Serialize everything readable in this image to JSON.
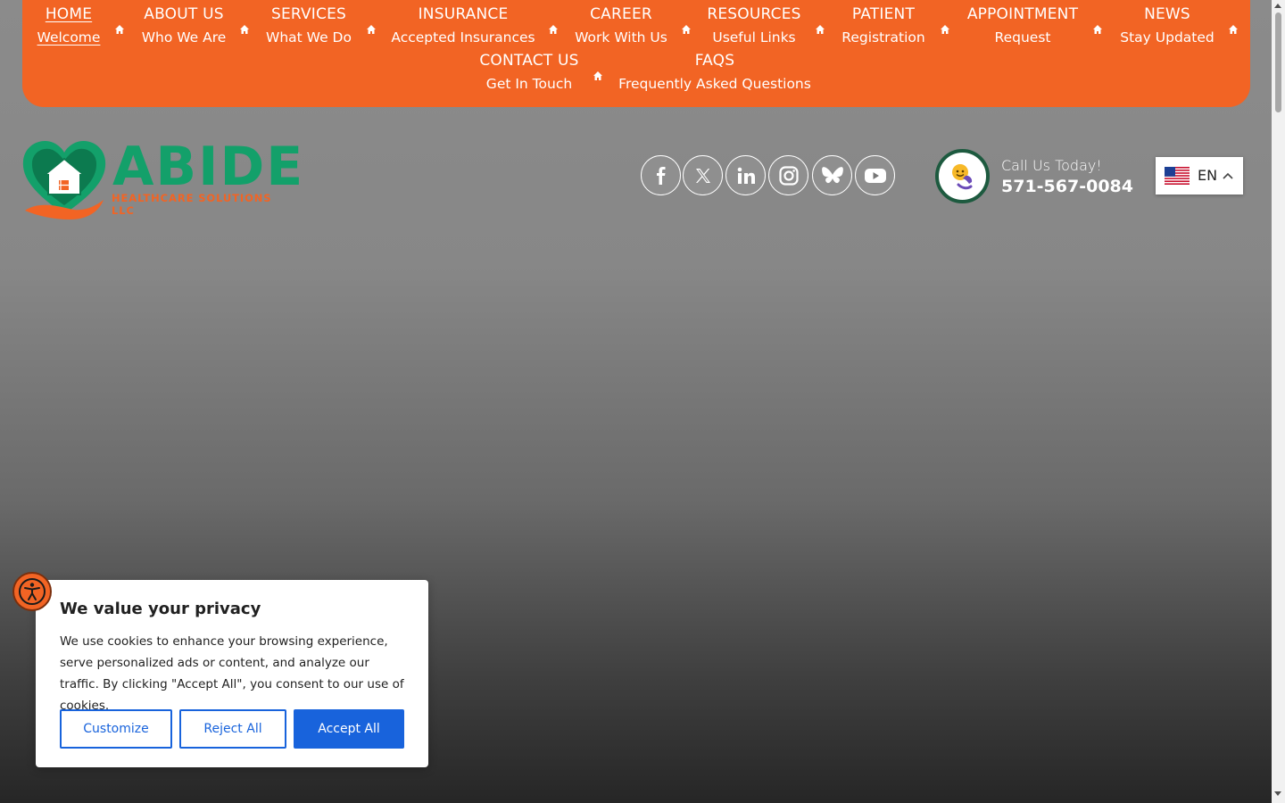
{
  "nav": {
    "row1": [
      {
        "main": "HOME",
        "sub": "Welcome",
        "active": true
      },
      {
        "main": "ABOUT US",
        "sub": "Who We Are"
      },
      {
        "main": "SERVICES",
        "sub": "What We Do"
      },
      {
        "main": "INSURANCE",
        "sub": "Accepted Insurances"
      },
      {
        "main": "CAREER",
        "sub": "Work With Us"
      },
      {
        "main": "RESOURCES",
        "sub": "Useful Links"
      },
      {
        "main": "PATIENT",
        "sub": "Registration"
      },
      {
        "main": "APPOINTMENT",
        "sub": "Request"
      },
      {
        "main": "NEWS",
        "sub": "Stay Updated"
      }
    ],
    "row2": [
      {
        "main": "CONTACT US",
        "sub": "Get In Touch"
      },
      {
        "main": "FAQS",
        "sub": "Frequently Asked Questions"
      }
    ],
    "separator_icon": "home-icon"
  },
  "logo": {
    "word": "ABIDE",
    "subtitle": "HEALTHCARE SOLUTIONS LLC"
  },
  "social": [
    "facebook-icon",
    "x-icon",
    "linkedin-icon",
    "instagram-icon",
    "bluesky-icon",
    "youtube-icon"
  ],
  "call": {
    "label": "Call Us Today!",
    "number": "571-567-0084",
    "icon": "phone-icon"
  },
  "language": {
    "code": "EN",
    "flag": "us-flag-icon"
  },
  "cookie": {
    "title": "We value your privacy",
    "text": "We use cookies to enhance your browsing experience, serve personalized ads or content, and analyze our traffic. By clicking \"Accept All\", you consent to our use of cookies.",
    "customize": "Customize",
    "reject": "Reject All",
    "accept": "Accept All"
  },
  "colors": {
    "nav_bg": "#f26424",
    "brand_green": "#13a06a",
    "brand_orange": "#f26424",
    "cookie_blue": "#1863dc"
  }
}
